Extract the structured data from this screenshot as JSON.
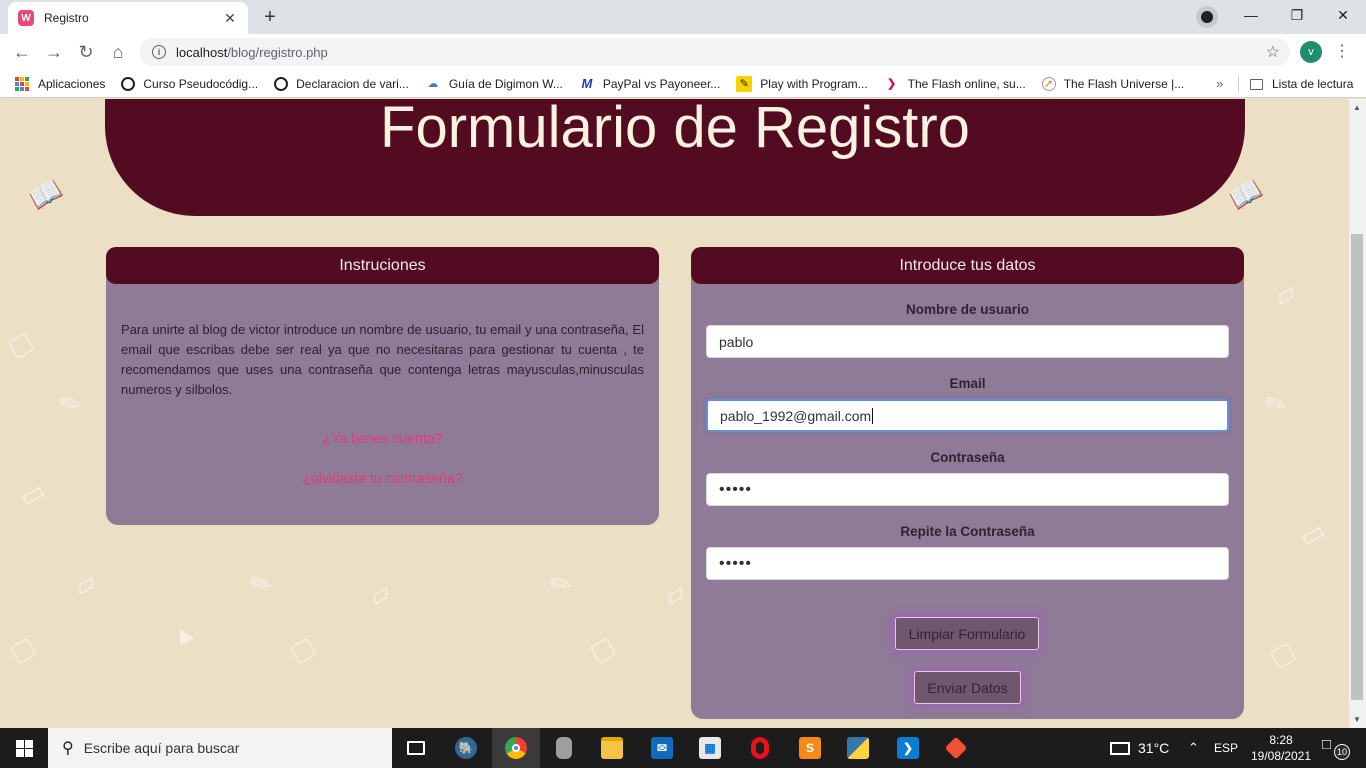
{
  "browser": {
    "tab_title": "Registro",
    "tab_favicon": "W",
    "tab_close": "✕",
    "new_tab": "+",
    "url_host": "localhost",
    "url_path": "/blog/registro.php",
    "profile_initial": "v",
    "window_controls": {
      "minimize": "—",
      "restore": "❐",
      "close": "✕"
    },
    "bookmarks": [
      {
        "label": "Aplicaciones",
        "icon": "apps-grid-icon"
      },
      {
        "label": "Curso Pseudocódig...",
        "icon": "github-icon"
      },
      {
        "label": "Declaracion de vari...",
        "icon": "github-icon"
      },
      {
        "label": "Guía de Digimon W...",
        "icon": "cloud-icon"
      },
      {
        "label": "PayPal vs Payoneer...",
        "icon": "m-logo-icon"
      },
      {
        "label": "Play with Program...",
        "icon": "pencil-icon"
      },
      {
        "label": "The Flash online, su...",
        "icon": "chevron-logo-icon"
      },
      {
        "label": "The Flash Universe |...",
        "icon": "compass-icon"
      }
    ],
    "bookmarks_more": "»",
    "reading_list": "Lista de lectura"
  },
  "page": {
    "title": "Formulario de Registro",
    "instructions": {
      "heading": "Instruciones",
      "text": "Para unirte al blog de victor introduce un nombre de usuario, tu email y una contraseña, El email que escribas debe ser real ya que no necesitaras para gestionar tu cuenta , te recomendamos que uses una contraseña que contenga letras mayusculas,minusculas numeros y silbolos.",
      "login_link": "¿Ya tienes cuenta?",
      "forgot_link": "¿olvidaste tu contraseña?"
    },
    "form": {
      "heading": "Introduce tus datos",
      "username_label": "Nombre de usuario",
      "username_value": "pablo",
      "email_label": "Email",
      "email_value": "pablo_1992@gmail.com",
      "password_label": "Contraseña",
      "password_value": "•••••",
      "repeat_label": "Repite la Contraseña",
      "repeat_value": "•••••",
      "clear_button": "Limpiar Formulario",
      "submit_button": "Enviar Datos"
    }
  },
  "taskbar": {
    "search_placeholder": "Escribe aquí para buscar",
    "weather": "31°C",
    "language": "ESP",
    "time": "8:28",
    "date": "19/08/2021",
    "notification_count": "10"
  }
}
